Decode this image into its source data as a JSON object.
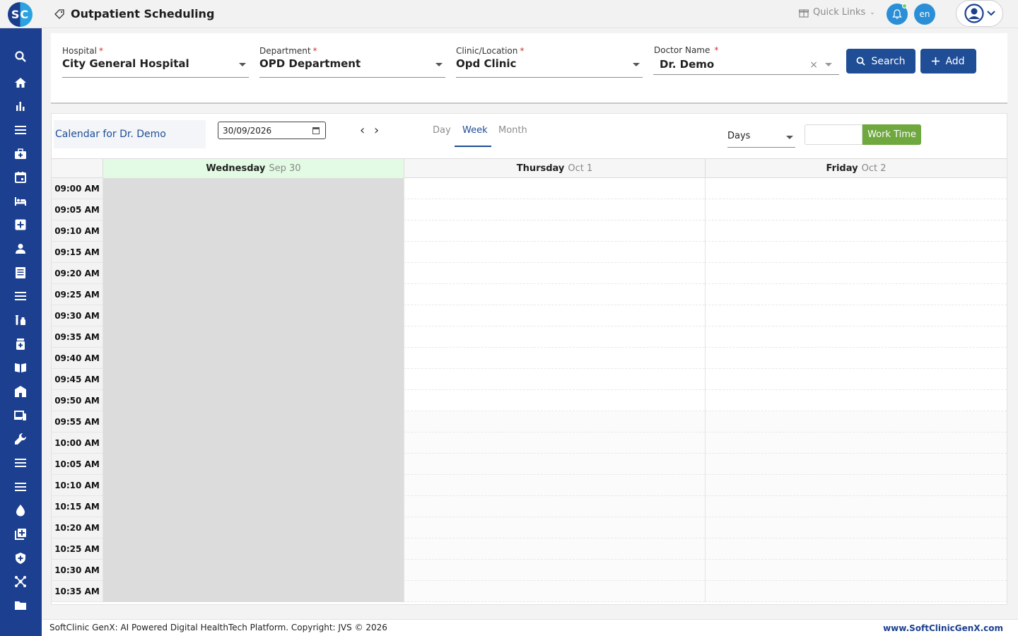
{
  "app": {
    "logo_text": "SC",
    "page_title": "Outpatient Scheduling",
    "quick_links": "Quick Links",
    "lang": "en"
  },
  "sidebar": {
    "icons": [
      "search-icon",
      "home-icon",
      "bar-chart-icon",
      "menu-icon",
      "briefcase-medical-icon",
      "calendar-icon",
      "bed-icon",
      "medical-plus-icon",
      "user-icon",
      "document-icon",
      "list-icon",
      "lab-tubes-icon",
      "pill-bottle-icon",
      "open-book-icon",
      "building-icon",
      "devices-icon",
      "wrench-icon",
      "menu-icon",
      "menu-icon",
      "blood-drop-icon",
      "add-copy-icon",
      "shield-icon",
      "network-icon",
      "folder-icon"
    ]
  },
  "filters": {
    "hospital": {
      "label": "Hospital",
      "value": "City General Hospital"
    },
    "department": {
      "label": "Department",
      "value": "OPD Department"
    },
    "clinic": {
      "label": "Clinic/Location",
      "value": "Opd Clinic"
    },
    "doctor": {
      "label": "Doctor Name",
      "value": "Dr. Demo"
    },
    "required_mark": "*",
    "clear_mark": "×",
    "search_label": "Search",
    "add_label": "Add"
  },
  "calendar": {
    "title": "Calendar for Dr. Demo",
    "date": "30/09/2026",
    "prev": "‹",
    "next": "›",
    "tabs": [
      "Day",
      "Week",
      "Month"
    ],
    "active_tab": "Week",
    "range_select": "Days",
    "work_time_label": "Work Time",
    "days": [
      {
        "name": "Wednesday",
        "date": "Sep 30",
        "today": true
      },
      {
        "name": "Thursday",
        "date": "Oct 1",
        "today": false
      },
      {
        "name": "Friday",
        "date": "Oct 2",
        "today": false
      }
    ],
    "times": [
      "09:00 AM",
      "09:05 AM",
      "09:10 AM",
      "09:15 AM",
      "09:20 AM",
      "09:25 AM",
      "09:30 AM",
      "09:35 AM",
      "09:40 AM",
      "09:45 AM",
      "09:50 AM",
      "09:55 AM",
      "10:00 AM",
      "10:05 AM",
      "10:10 AM",
      "10:15 AM",
      "10:20 AM",
      "10:25 AM",
      "10:30 AM",
      "10:35 AM"
    ]
  },
  "footer": {
    "copyright": "SoftClinic GenX: AI Powered Digital HealthTech Platform. Copyright: JVS © 2026",
    "site": "www.SoftClinicGenX.com"
  },
  "colors": {
    "brand": "#1c3f8f",
    "button": "#1f4d96",
    "accent": "#2a8fd6",
    "work_time": "#6fa83e",
    "today_header": "#e3fbe4",
    "blocked": "#dcdcdc"
  }
}
